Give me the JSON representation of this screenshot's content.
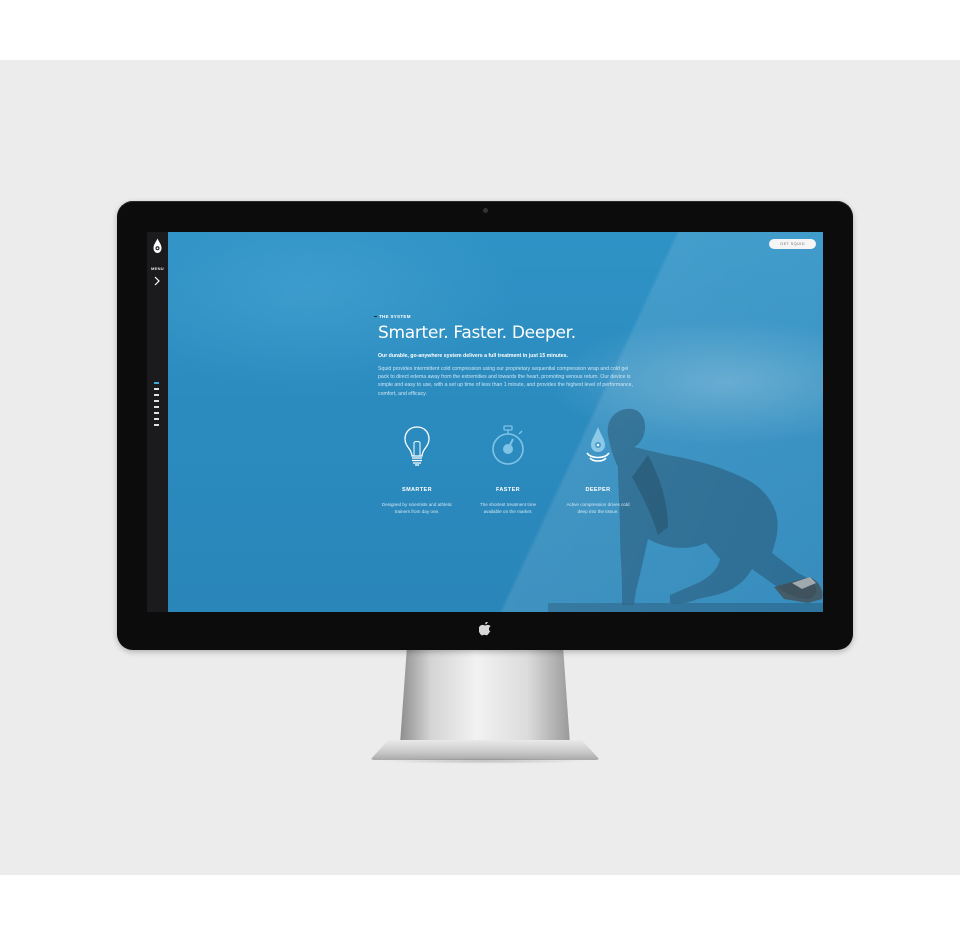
{
  "sidebar": {
    "menu_label": "MENU",
    "pager_count": 8,
    "pager_active": 0
  },
  "header": {
    "cta_label": "GET SQUID"
  },
  "hero": {
    "eyebrow": "THE SYSTEM",
    "headline": "Smarter. Faster. Deeper.",
    "lede": "Our durable, go-anywhere system delivers a full treatment in just 15 minutes.",
    "body": "Squid provides intermittent cold compression using our proprietary sequential compression wrap and cold gel pack to direct edema away from the extremities and towards the heart, promoting venous return. Our device is simple and easy to use, with a set up time of less than 1 minute, and provides the highest level of performance, comfort, and efficacy."
  },
  "features": [
    {
      "icon": "lightbulb-icon",
      "title": "SMARTER",
      "desc": "Designed by scientists and athletic trainers from day one."
    },
    {
      "icon": "stopwatch-icon",
      "title": "FASTER",
      "desc": "The shortest treatment time available on the market."
    },
    {
      "icon": "droplet-waves-icon",
      "title": "DEEPER",
      "desc": "Active compression drives cold deep into the tissue."
    }
  ],
  "colors": {
    "accent": "#2b8ec1",
    "sidebar": "#1b1b1d",
    "bezel": "#0c0c0c"
  }
}
